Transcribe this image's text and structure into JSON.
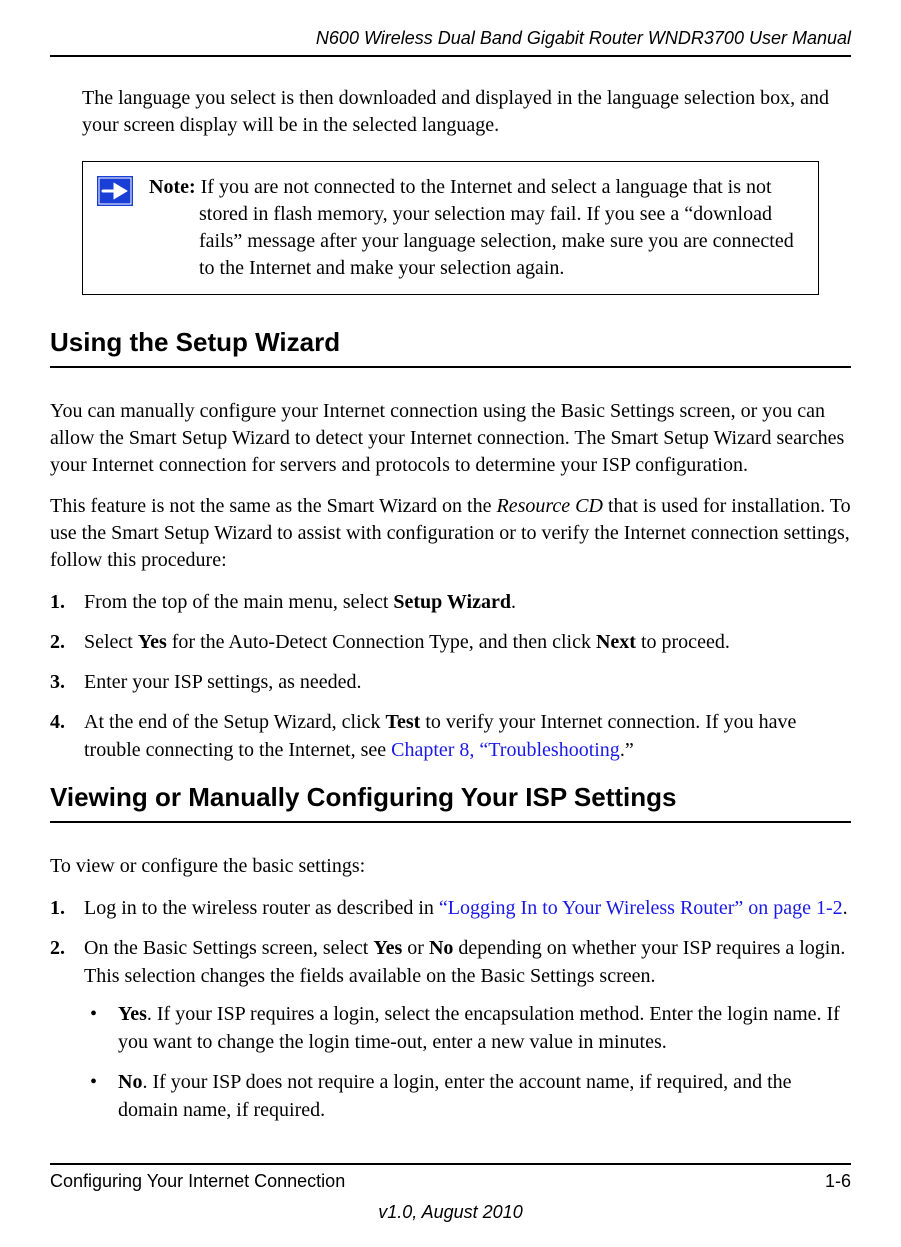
{
  "header": {
    "title": "N600 Wireless Dual Band Gigabit Router WNDR3700 User Manual"
  },
  "intro": "The language you select is then downloaded and displayed in the language selection box, and your screen display will be in the selected language.",
  "note": {
    "label": "Note:",
    "text": " If you are not connected to the Internet and select a language that is not stored in flash memory, your selection may fail. If you see a “download fails” message after your language selection, make sure you are connected to the Internet and make your selection again."
  },
  "section1": {
    "title": "Using the Setup Wizard",
    "para1": "You can manually configure your Internet connection using the Basic Settings screen, or you can allow the Smart Setup Wizard to detect your Internet connection. The Smart Setup Wizard searches your Internet connection for servers and protocols to determine your ISP configuration.",
    "para2_pre": "This feature is not the same as the Smart Wizard on the ",
    "para2_em": "Resource CD",
    "para2_post": " that is used for installation. To use the Smart Setup Wizard to assist with configuration or to verify the Internet connection settings, follow this procedure:",
    "steps": {
      "s1_pre": "From the top of the main menu, select ",
      "s1_b": "Setup Wizard",
      "s1_post": ".",
      "s2_pre": "Select ",
      "s2_b1": "Yes",
      "s2_mid": " for the Auto-Detect Connection Type, and then click ",
      "s2_b2": "Next",
      "s2_post": " to proceed.",
      "s3": "Enter your ISP settings, as needed.",
      "s4_pre": "At the end of the Setup Wizard, click ",
      "s4_b": "Test",
      "s4_mid": " to verify your Internet connection. If you have trouble connecting to the Internet, see ",
      "s4_link": "Chapter 8, “Troubleshooting",
      "s4_post": ".”"
    }
  },
  "section2": {
    "title": "Viewing or Manually Configuring Your ISP Settings",
    "intro": "To view or configure the basic settings:",
    "steps": {
      "s1_pre": "Log in to the wireless router as described in ",
      "s1_link": "“Logging In to Your Wireless Router” on page 1-2",
      "s1_post": ".",
      "s2_pre": "On the Basic Settings screen, select ",
      "s2_b1": "Yes",
      "s2_mid1": " or ",
      "s2_b2": "No",
      "s2_post": " depending on whether your ISP requires a login. This selection changes the fields available on the Basic Settings screen.",
      "bullet1_b": "Yes",
      "bullet1_text": ". If your ISP requires a login, select the encapsulation method. Enter the login name. If you want to change the login time-out, enter a new value in minutes.",
      "bullet2_b": "No",
      "bullet2_text": ". If your ISP does not require a login, enter the account name, if required, and the domain name, if required."
    }
  },
  "footer": {
    "left": "Configuring Your Internet Connection",
    "right": "1-6",
    "version": "v1.0, August 2010"
  }
}
